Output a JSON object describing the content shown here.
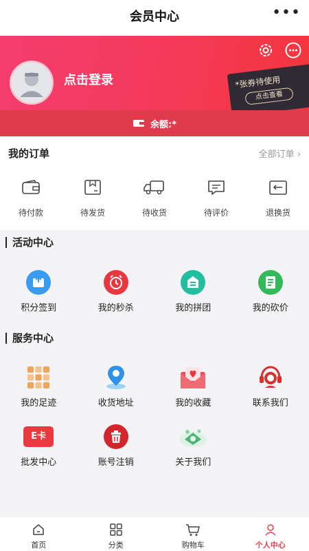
{
  "header": {
    "title": "会员中心",
    "more": "•••"
  },
  "hero": {
    "login_text": "点击登录",
    "coupon_title": "*张券待使用",
    "coupon_button": "点击查看",
    "balance_label": "余额:*"
  },
  "orders": {
    "title": "我的订单",
    "all_label": "全部订单",
    "items": [
      {
        "label": "待付款",
        "icon": "wallet-icon"
      },
      {
        "label": "待发货",
        "icon": "box-icon"
      },
      {
        "label": "待收货",
        "icon": "truck-icon"
      },
      {
        "label": "待评价",
        "icon": "comment-icon"
      },
      {
        "label": "退换货",
        "icon": "return-icon"
      }
    ]
  },
  "activity": {
    "title": "活动中心",
    "items": [
      {
        "label": "积分签到",
        "icon": "sign-in-icon",
        "color": "#3a9cf0"
      },
      {
        "label": "我的秒杀",
        "icon": "alarm-clock-icon",
        "color": "#e8373f"
      },
      {
        "label": "我的拼团",
        "icon": "group-buy-icon",
        "color": "#21bfa0"
      },
      {
        "label": "我的砍价",
        "icon": "bargain-icon",
        "color": "#33b85a"
      }
    ]
  },
  "services": {
    "title": "服务中心",
    "items": [
      {
        "label": "我的足迹",
        "icon": "footprint-grid-icon"
      },
      {
        "label": "收货地址",
        "icon": "location-pin-icon"
      },
      {
        "label": "我的收藏",
        "icon": "favorite-envelope-icon"
      },
      {
        "label": "联系我们",
        "icon": "customer-service-icon"
      },
      {
        "label": "批发中心",
        "icon": "e-card-icon",
        "badge": "E卡"
      },
      {
        "label": "账号注销",
        "icon": "trash-icon"
      },
      {
        "label": "关于我们",
        "icon": "about-icon"
      }
    ]
  },
  "tabbar": {
    "items": [
      {
        "label": "首页",
        "icon": "home-icon"
      },
      {
        "label": "分类",
        "icon": "category-grid-icon"
      },
      {
        "label": "购物车",
        "icon": "cart-icon"
      },
      {
        "label": "个人中心",
        "icon": "person-icon"
      }
    ],
    "active_index": 3,
    "active_color": "#e93d4a"
  }
}
